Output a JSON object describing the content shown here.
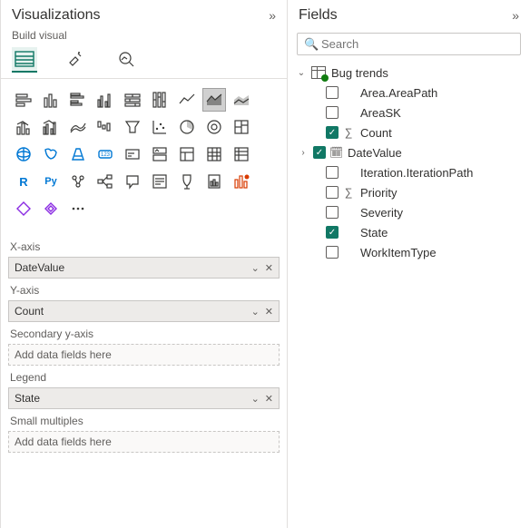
{
  "viz_pane": {
    "title": "Visualizations",
    "subtitle": "Build visual",
    "wells": {
      "x_axis": {
        "label": "X-axis",
        "value": "DateValue"
      },
      "y_axis": {
        "label": "Y-axis",
        "value": "Count"
      },
      "secondary_y": {
        "label": "Secondary y-axis",
        "placeholder": "Add data fields here"
      },
      "legend": {
        "label": "Legend",
        "value": "State"
      },
      "small_multiples": {
        "label": "Small multiples",
        "placeholder": "Add data fields here"
      }
    }
  },
  "fields_pane": {
    "title": "Fields",
    "search_placeholder": "Search",
    "table": {
      "name": "Bug trends",
      "fields": [
        {
          "name": "Area.AreaPath",
          "checked": false,
          "type": ""
        },
        {
          "name": "AreaSK",
          "checked": false,
          "type": ""
        },
        {
          "name": "Count",
          "checked": true,
          "type": "sum"
        },
        {
          "name": "DateValue",
          "checked": true,
          "type": "date",
          "expandable": true
        },
        {
          "name": "Iteration.IterationPath",
          "checked": false,
          "type": ""
        },
        {
          "name": "Priority",
          "checked": false,
          "type": "sum"
        },
        {
          "name": "Severity",
          "checked": false,
          "type": ""
        },
        {
          "name": "State",
          "checked": true,
          "type": ""
        },
        {
          "name": "WorkItemType",
          "checked": false,
          "type": ""
        }
      ]
    }
  }
}
